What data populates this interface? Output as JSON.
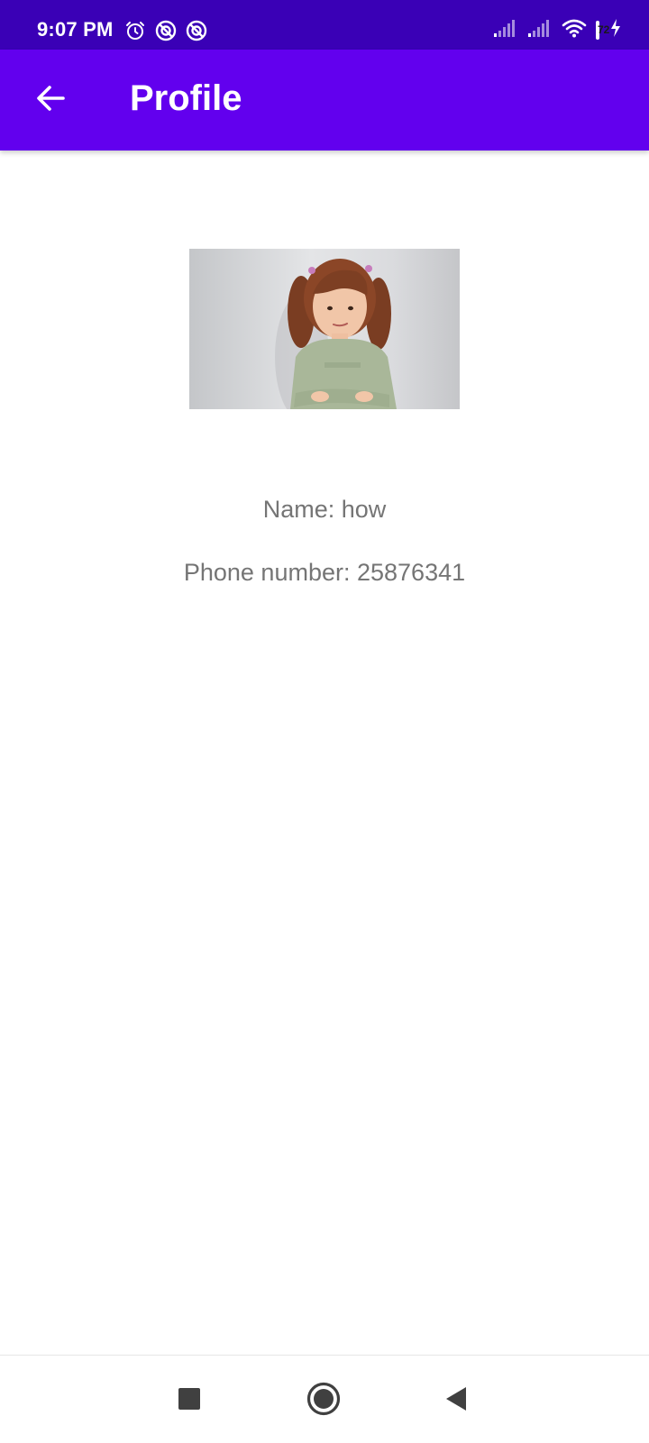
{
  "status_bar": {
    "time": "9:07 PM",
    "battery_level": "72",
    "battery_fraction": 0.72,
    "background_color": "#3a00b6",
    "left_icons": [
      "alarm-icon",
      "data-saver-icon",
      "data-saver-icon"
    ],
    "right_icons": [
      "signal-icon",
      "signal-icon",
      "wifi-icon",
      "battery-icon",
      "charging-icon"
    ]
  },
  "app_bar": {
    "title": "Profile",
    "back_icon": "arrow-back-icon",
    "background_color": "#6200ee"
  },
  "profile": {
    "photo_icon": "profile-photo",
    "name_text": "Name: how",
    "phone_text": "Phone number: 25876341",
    "text_color": "#757575"
  },
  "nav_bar": {
    "icons": [
      "recents-icon",
      "home-icon",
      "back-icon"
    ]
  }
}
